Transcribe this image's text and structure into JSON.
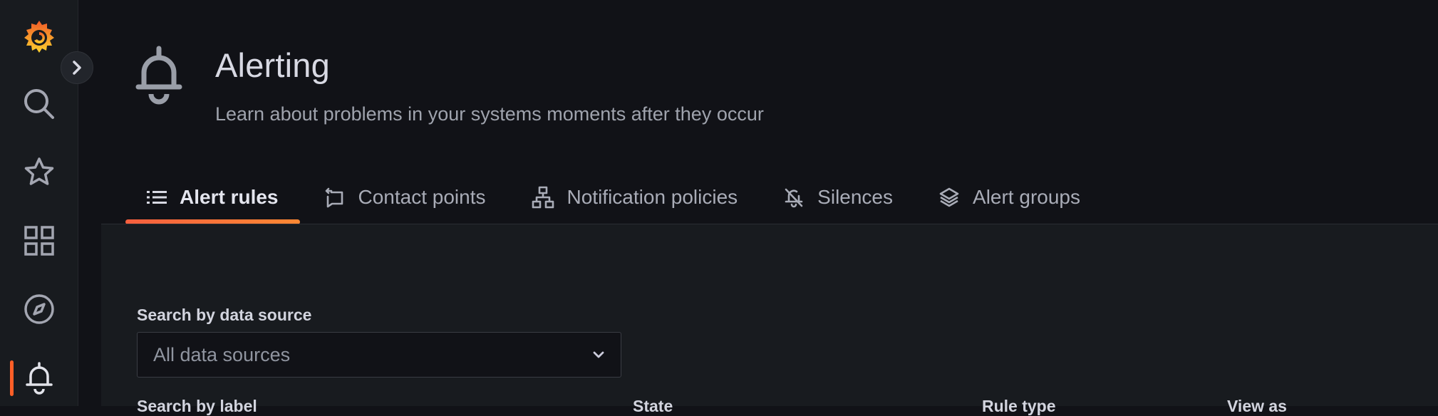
{
  "colors": {
    "accent": "#ff5f27",
    "background": "#111217",
    "panel": "#181b1f"
  },
  "sidebar": {
    "items": [
      {
        "name": "grafana-logo",
        "icon": "grafana-logo-icon"
      },
      {
        "name": "search",
        "icon": "search-icon"
      },
      {
        "name": "starred",
        "icon": "star-icon"
      },
      {
        "name": "dashboards",
        "icon": "apps-icon"
      },
      {
        "name": "explore",
        "icon": "compass-icon"
      },
      {
        "name": "alerting",
        "icon": "bell-icon",
        "active": true
      }
    ],
    "expand_icon": "chevron-right-icon"
  },
  "header": {
    "icon": "bell-icon",
    "title": "Alerting",
    "subtitle": "Learn about problems in your systems moments after they occur"
  },
  "tabs": [
    {
      "label": "Alert rules",
      "icon": "list-icon",
      "active": true
    },
    {
      "label": "Contact points",
      "icon": "comment-alt-share-icon"
    },
    {
      "label": "Notification policies",
      "icon": "sitemap-icon"
    },
    {
      "label": "Silences",
      "icon": "bell-slash-icon"
    },
    {
      "label": "Alert groups",
      "icon": "layer-group-icon"
    }
  ],
  "filters": {
    "datasource_label": "Search by data source",
    "datasource_value": "All data sources",
    "cut_labels": [
      "Search by label",
      "State",
      "Rule type",
      "View as"
    ]
  }
}
